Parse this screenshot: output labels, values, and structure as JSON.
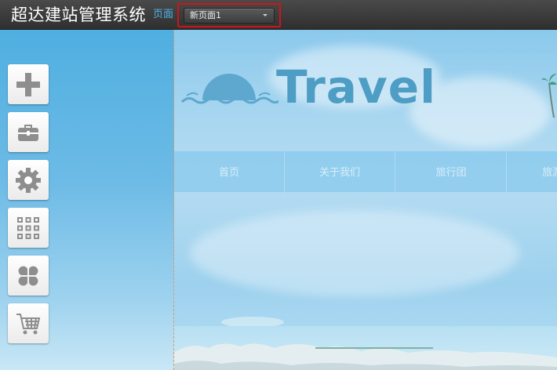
{
  "header": {
    "app_title": "超达建站管理系统",
    "page_label": "页面",
    "page_select": {
      "selected": "新页面1"
    }
  },
  "toolbar": {
    "tools": [
      {
        "name": "add-element",
        "icon": "plus-icon"
      },
      {
        "name": "toolbox",
        "icon": "toolbox-icon"
      },
      {
        "name": "settings",
        "icon": "gear-icon"
      },
      {
        "name": "apps",
        "icon": "grid-icon"
      },
      {
        "name": "modules",
        "icon": "clover-icon"
      },
      {
        "name": "shop",
        "icon": "cart-icon"
      }
    ]
  },
  "preview": {
    "logo_text": "Travel",
    "nav": [
      "首页",
      "关于我们",
      "旅行团",
      "旅游"
    ]
  },
  "colors": {
    "topbar": "#3a3a3a",
    "accent": "#4fb3ea",
    "highlight_border": "#d0141a",
    "logo": "#4e9dc4"
  }
}
